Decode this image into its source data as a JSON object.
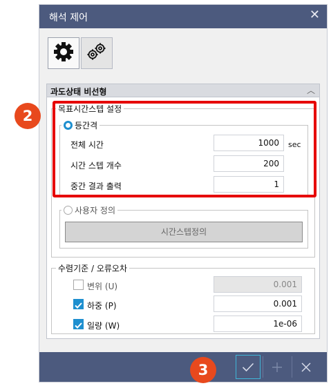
{
  "dialog": {
    "title": "해석 제어",
    "close_glyph": "✕"
  },
  "toolbar": {
    "buttons": [
      {
        "icon": "gear-icon",
        "selected": true
      },
      {
        "icon": "gears-icon",
        "selected": false
      }
    ]
  },
  "panel": {
    "title": "과도상태 비선형",
    "collapse_glyph": "︿",
    "target_step_group": {
      "legend": "목표시간스텝 설정",
      "equal_interval": {
        "label": "등간격",
        "selected": true,
        "rows": [
          {
            "label": "전체 시간",
            "value": "1000",
            "unit": "sec"
          },
          {
            "label": "시간 스텝 개수",
            "value": "200",
            "unit": ""
          },
          {
            "label": "중간 결과 출력",
            "value": "1",
            "unit": ""
          }
        ]
      },
      "user_defined": {
        "label": "사용자 정의",
        "selected": false,
        "button_label": "시간스텝정의"
      }
    },
    "convergence_group": {
      "legend": "수렴기준 / 오류오차",
      "rows": [
        {
          "label": "변위 (U)",
          "checked": false,
          "value": "0.001",
          "enabled": false
        },
        {
          "label": "하중 (P)",
          "checked": true,
          "value": "0.001",
          "enabled": true
        },
        {
          "label": "일량 (W)",
          "checked": true,
          "value": "1e-06",
          "enabled": true
        }
      ]
    }
  },
  "footer": {
    "buttons": [
      {
        "icon": "check-icon",
        "enabled": true
      },
      {
        "icon": "plus-icon",
        "enabled": false
      },
      {
        "icon": "close-icon",
        "enabled": true
      }
    ]
  },
  "annotations": {
    "marker_2": "2",
    "marker_3": "3"
  },
  "colors": {
    "title_bar": "#4c5a7e",
    "accent": "#1e8fcf",
    "highlight": "#e60000",
    "marker": "#e8491d"
  }
}
